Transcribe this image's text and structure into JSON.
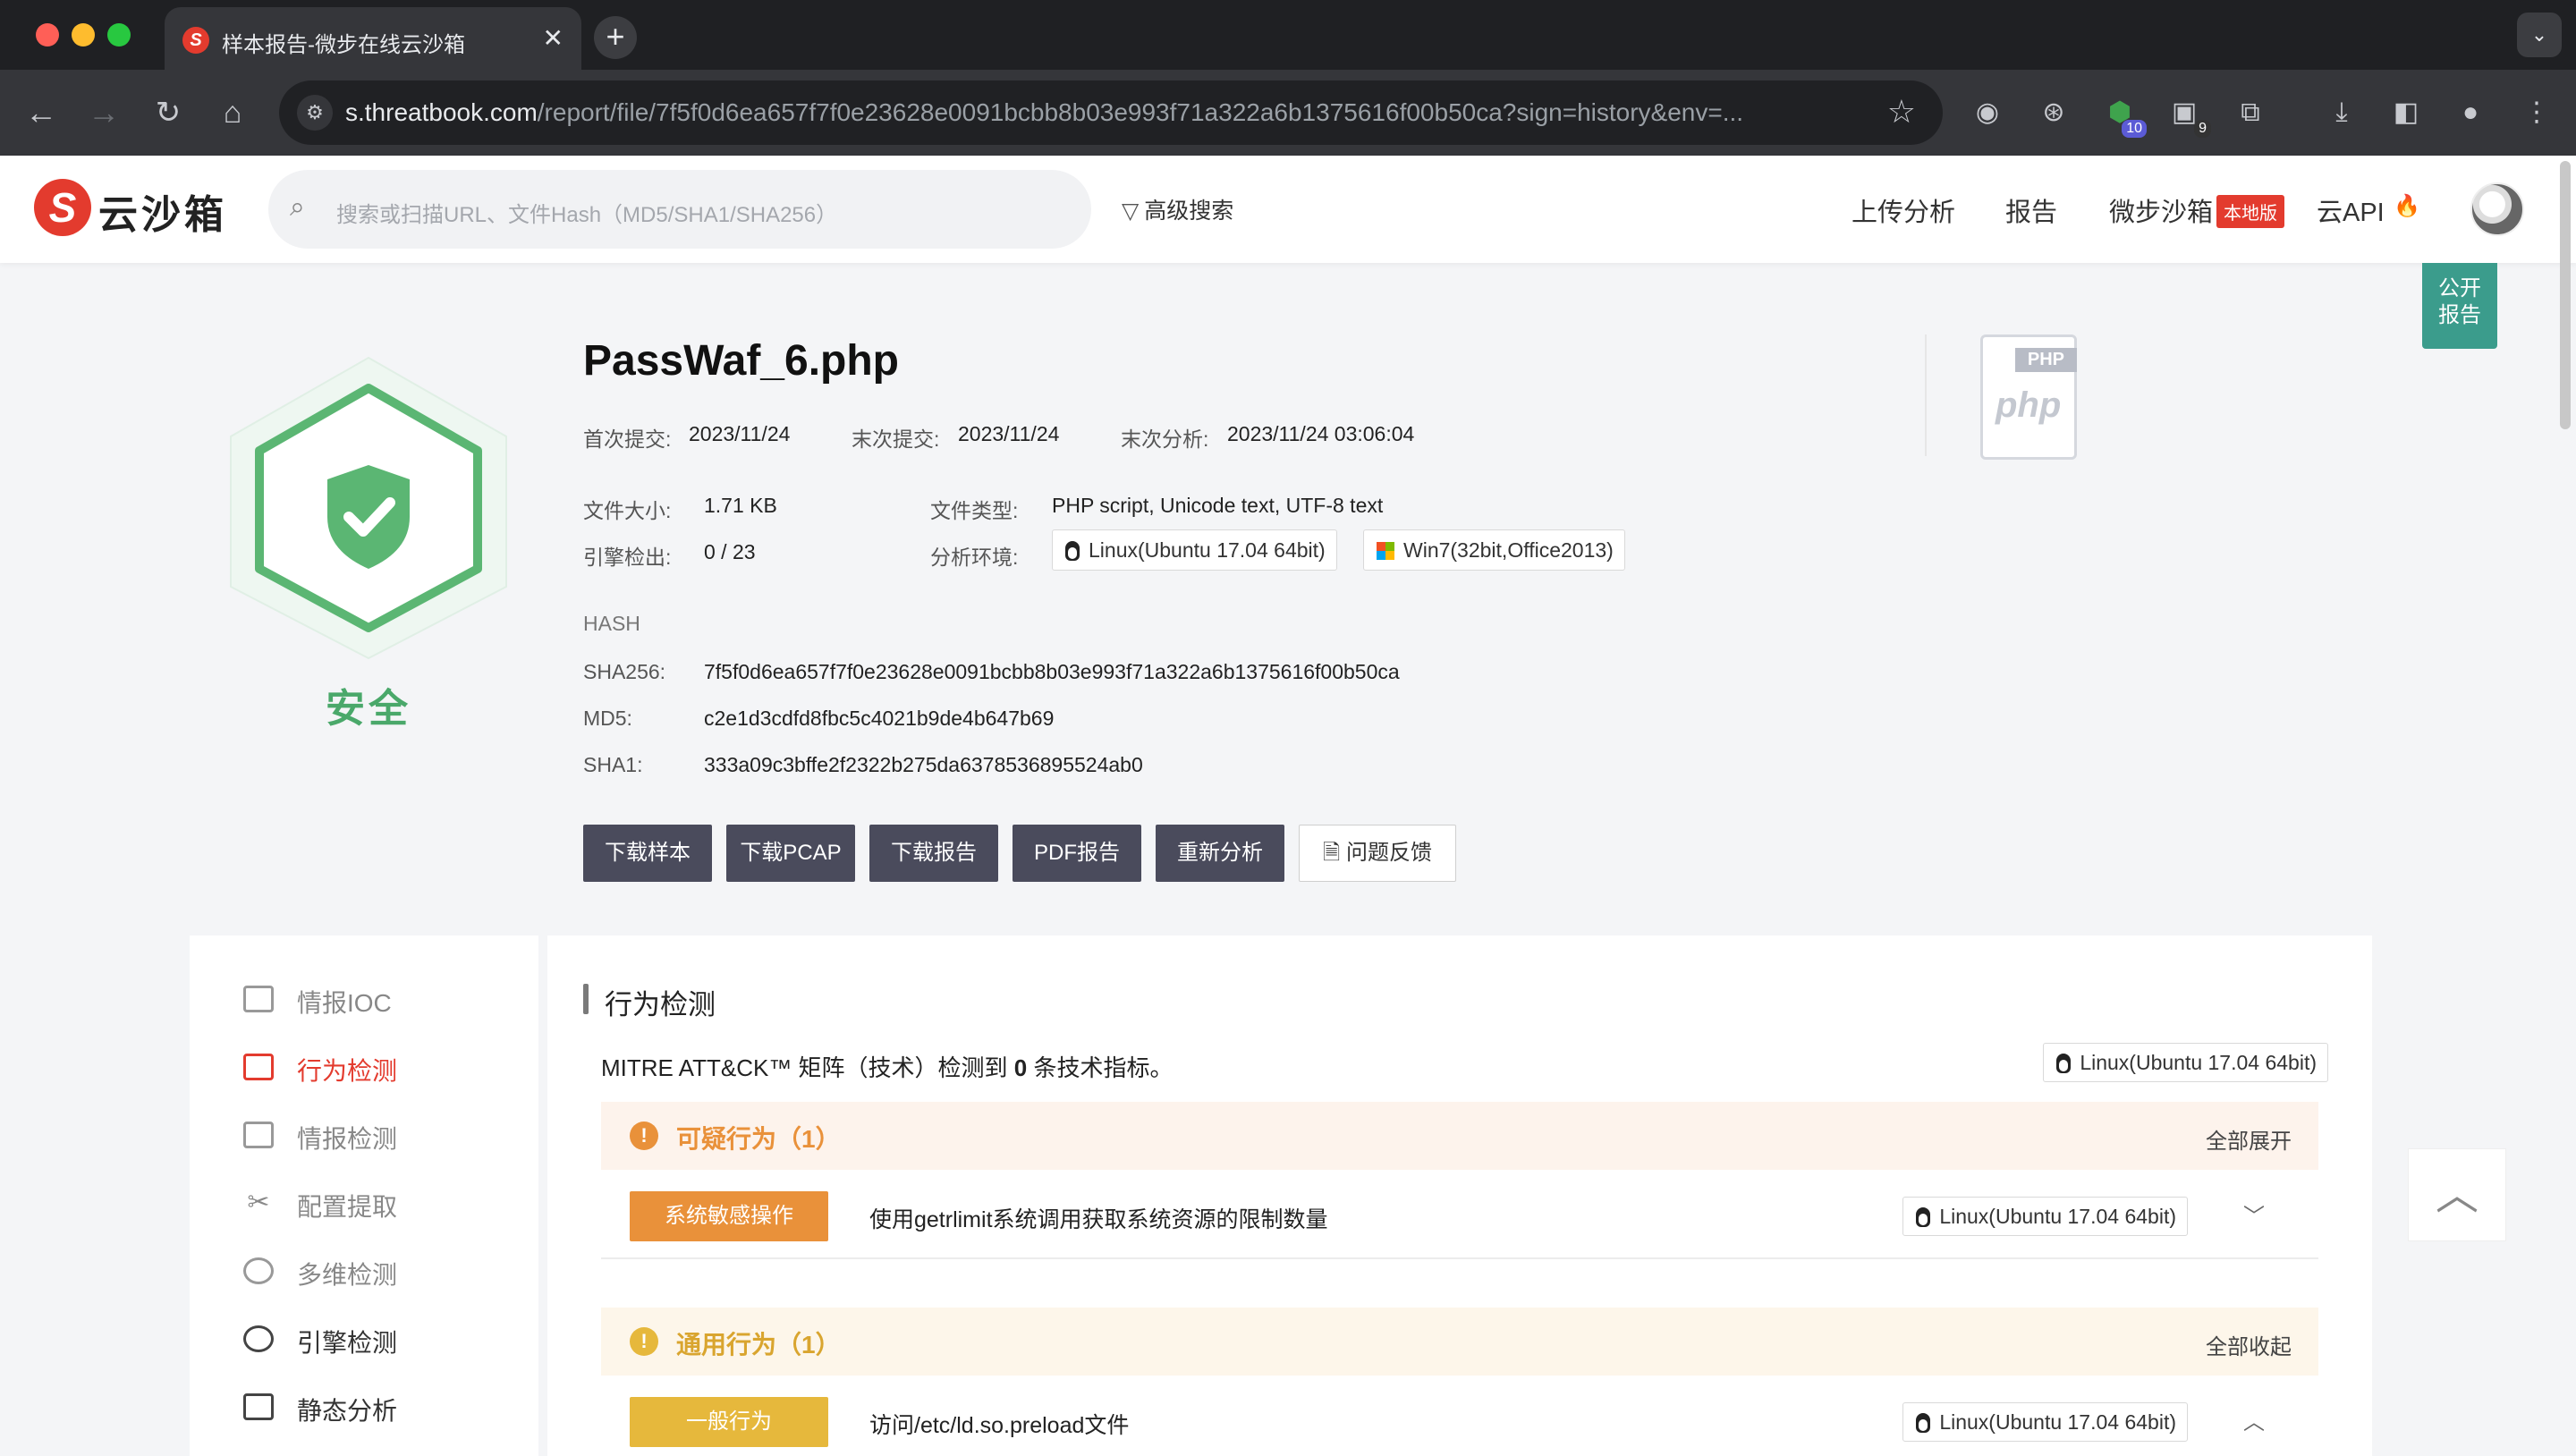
{
  "browser": {
    "tab_title": "样本报告-微步在线云沙箱",
    "tab_favicon": "S",
    "url_host": "s.threatbook.com",
    "url_path": "/report/file/7f5f0d6ea657f7f0e23628e0091bcbb8b03e993f71a322a6b1375616f00b50ca?sign=history&env=...",
    "ext_badge_1": "10",
    "ext_badge_2": "9"
  },
  "header": {
    "logo_mark": "S",
    "logo_text": "云沙箱",
    "search_placeholder": "搜索或扫描URL、文件Hash（MD5/SHA1/SHA256）",
    "advanced_search": "高级搜索",
    "nav": {
      "upload": "上传分析",
      "report": "报告",
      "sandbox": "微步沙箱",
      "local_badge": "本地版",
      "api": "云API"
    }
  },
  "public_report": "公开\n报告",
  "verdict": {
    "label": "安全",
    "color": "#4aa86a"
  },
  "file": {
    "name": "PassWaf_6.php",
    "first_submit_label": "首次提交:",
    "first_submit": "2023/11/24",
    "last_submit_label": "末次提交:",
    "last_submit": "2023/11/24",
    "last_analysis_label": "末次分析:",
    "last_analysis": "2023/11/24 03:06:04",
    "size_label": "文件大小:",
    "size": "1.71 KB",
    "type_label": "文件类型:",
    "type": "PHP script, Unicode text, UTF-8 text",
    "engines_label": "引擎检出:",
    "engines": "0 / 23",
    "env_label": "分析环境:",
    "env_linux": "Linux(Ubuntu 17.04 64bit)",
    "env_win": "Win7(32bit,Office2013)",
    "icon_tag": "PHP",
    "icon_word": "php"
  },
  "hash": {
    "heading": "HASH",
    "sha256_label": "SHA256:",
    "sha256": "7f5f0d6ea657f7f0e23628e0091bcbb8b03e993f71a322a6b1375616f00b50ca",
    "md5_label": "MD5:",
    "md5": "c2e1d3cdfd8fbc5c4021b9de4b647b69",
    "sha1_label": "SHA1:",
    "sha1": "333a09c3bffe2f2322b275da6378536895524ab0"
  },
  "actions": {
    "download_sample": "下载样本",
    "download_pcap": "下载PCAP",
    "download_report": "下载报告",
    "pdf_report": "PDF报告",
    "reanalyze": "重新分析",
    "feedback": "问题反馈"
  },
  "sidebar": {
    "items": [
      {
        "label": "情报IOC"
      },
      {
        "label": "行为检测"
      },
      {
        "label": "情报检测"
      },
      {
        "label": "配置提取"
      },
      {
        "label": "多维检测"
      },
      {
        "label": "引擎检测"
      },
      {
        "label": "静态分析"
      }
    ]
  },
  "behavior": {
    "title": "行为检测",
    "mitre_prefix": "MITRE ATT&CK™ 矩阵（技术）检测到 ",
    "mitre_count": "0",
    "mitre_suffix": " 条技术指标。",
    "env": "Linux(Ubuntu 17.04 64bit)",
    "groups": [
      {
        "title": "可疑行为（1）",
        "toggle": "全部展开",
        "row": {
          "tag": "系统敏感操作",
          "desc": "使用getrlimit系统调用获取系统资源的限制数量",
          "env": "Linux(Ubuntu 17.04 64bit)"
        }
      },
      {
        "title": "通用行为（1）",
        "toggle": "全部收起",
        "row": {
          "tag": "一般行为",
          "desc": "访问/etc/ld.so.preload文件",
          "env": "Linux(Ubuntu 17.04 64bit)"
        }
      }
    ]
  }
}
